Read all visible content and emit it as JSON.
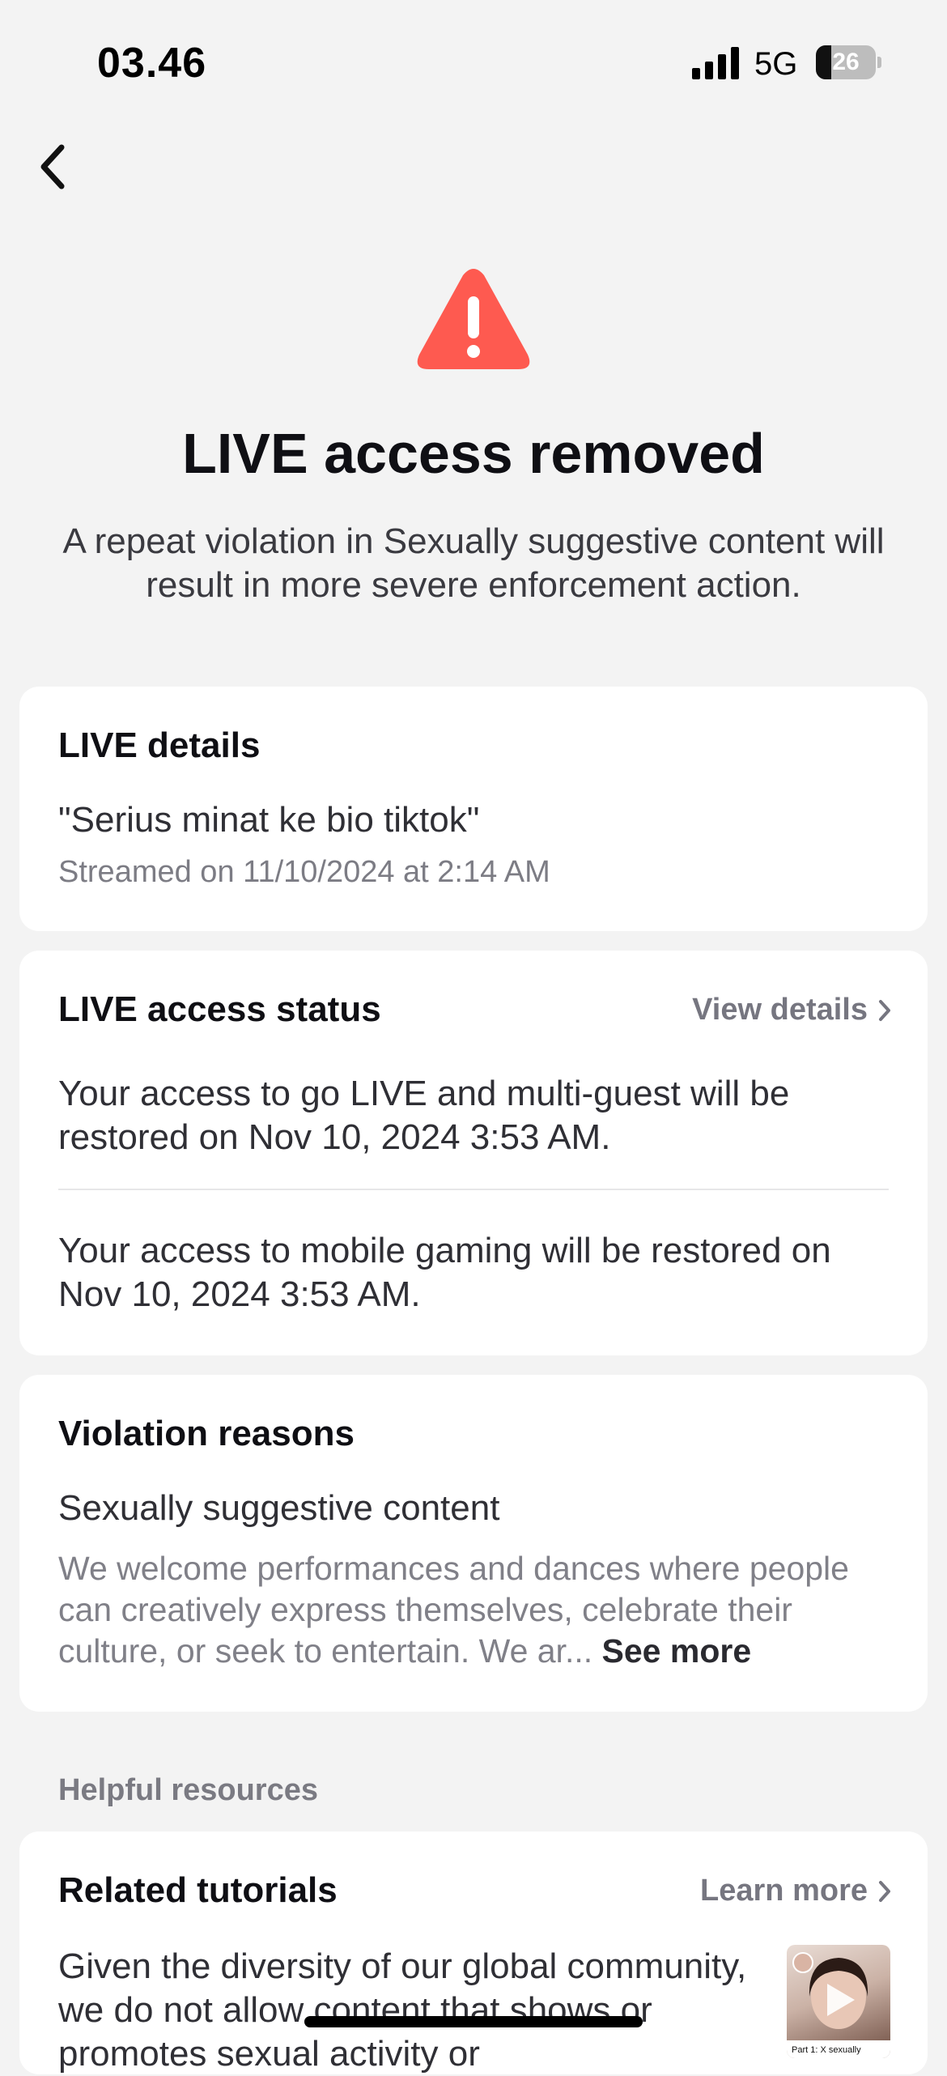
{
  "status_bar": {
    "time": "03.46",
    "network": "5G",
    "battery": "26",
    "battery_level_percent": 26
  },
  "header": {
    "back_icon": "chevron-left-icon"
  },
  "alert": {
    "icon": "warning-triangle-icon",
    "icon_color": "#fe5a50",
    "title": "LIVE access removed",
    "subtitle": "A repeat violation in Sexually suggestive content will result in more severe enforcement action."
  },
  "live_details": {
    "heading": "LIVE details",
    "stream_title": "\"Serius minat ke bio tiktok\"",
    "streamed_on": "Streamed on 11/10/2024 at 2:14 AM"
  },
  "access_status": {
    "heading": "LIVE access status",
    "link_label": "View details",
    "items": [
      "Your access to go LIVE and multi-guest will be restored on Nov 10, 2024 3:53 AM.",
      "Your access to mobile gaming will be restored on Nov 10, 2024 3:53 AM."
    ]
  },
  "violation": {
    "heading": "Violation reasons",
    "reason": "Sexually suggestive content",
    "description": "We welcome performances and dances where people can creatively express themselves, celebrate their culture, or seek to entertain. We ar...",
    "see_more": "See more"
  },
  "resources": {
    "section_label": "Helpful resources",
    "tutorials_heading": "Related tutorials",
    "learn_more": "Learn more",
    "tutorial_text": "Given the diversity of our global community, we do not allow content that shows or promotes sexual activity or",
    "thumbnail_caption": "Part 1: X sexually"
  }
}
